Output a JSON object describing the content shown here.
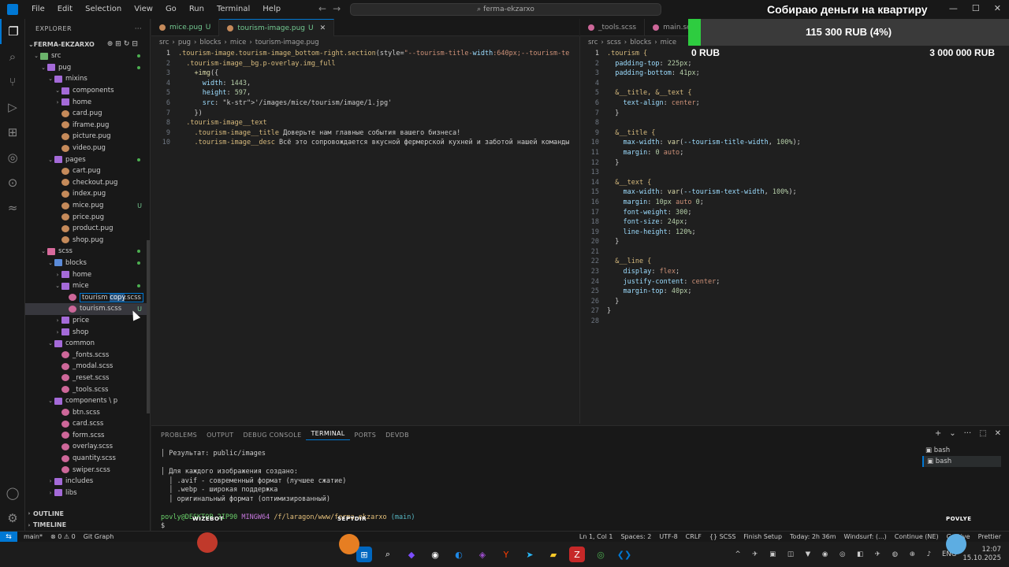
{
  "titlebar": {
    "menu": [
      "File",
      "Edit",
      "Selection",
      "View",
      "Go",
      "Run",
      "Terminal",
      "Help"
    ],
    "search": "ferma-ekzarxo"
  },
  "sidebar": {
    "header": "EXPLORER",
    "project": "FERMA-EKZARXO",
    "rows": [
      {
        "label": "src",
        "indent": 1,
        "type": "folder-src",
        "open": true,
        "dot": true
      },
      {
        "label": "pug",
        "indent": 2,
        "type": "folder",
        "open": true,
        "dot": true
      },
      {
        "label": "mixins",
        "indent": 3,
        "type": "folder",
        "open": true
      },
      {
        "label": "components",
        "indent": 4,
        "type": "folder",
        "open": true
      },
      {
        "label": "home",
        "indent": 4,
        "type": "folder",
        "open": false
      },
      {
        "label": "card.pug",
        "indent": 4,
        "type": "pug"
      },
      {
        "label": "iframe.pug",
        "indent": 4,
        "type": "pug"
      },
      {
        "label": "picture.pug",
        "indent": 4,
        "type": "pug"
      },
      {
        "label": "video.pug",
        "indent": 4,
        "type": "pug"
      },
      {
        "label": "pages",
        "indent": 3,
        "type": "folder",
        "open": true,
        "dot": true
      },
      {
        "label": "cart.pug",
        "indent": 4,
        "type": "pug"
      },
      {
        "label": "checkout.pug",
        "indent": 4,
        "type": "pug"
      },
      {
        "label": "index.pug",
        "indent": 4,
        "type": "pug"
      },
      {
        "label": "mice.pug",
        "indent": 4,
        "type": "pug",
        "badge": "U",
        "green": true
      },
      {
        "label": "price.pug",
        "indent": 4,
        "type": "pug"
      },
      {
        "label": "product.pug",
        "indent": 4,
        "type": "pug"
      },
      {
        "label": "shop.pug",
        "indent": 4,
        "type": "pug"
      },
      {
        "label": "scss",
        "indent": 2,
        "type": "folder-pink",
        "open": true,
        "dot": true
      },
      {
        "label": "blocks",
        "indent": 3,
        "type": "folder-blue",
        "open": true,
        "dot": true
      },
      {
        "label": "home",
        "indent": 4,
        "type": "folder",
        "open": false
      },
      {
        "label": "mice",
        "indent": 4,
        "type": "folder",
        "open": true,
        "dot": true,
        "green": true
      },
      {
        "label": "tourism copy.scss",
        "indent": 5,
        "type": "scss",
        "renaming": true
      },
      {
        "label": "tourism.scss",
        "indent": 5,
        "type": "scss",
        "badge": "U",
        "green": true,
        "selected": true
      },
      {
        "label": "price",
        "indent": 4,
        "type": "folder",
        "open": false
      },
      {
        "label": "shop",
        "indent": 4,
        "type": "folder",
        "open": false
      },
      {
        "label": "common",
        "indent": 3,
        "type": "folder",
        "open": true
      },
      {
        "label": "_fonts.scss",
        "indent": 4,
        "type": "scss"
      },
      {
        "label": "_modal.scss",
        "indent": 4,
        "type": "scss"
      },
      {
        "label": "_reset.scss",
        "indent": 4,
        "type": "scss"
      },
      {
        "label": "_tools.scss",
        "indent": 4,
        "type": "scss"
      },
      {
        "label": "components \\ p",
        "indent": 3,
        "type": "folder",
        "open": true
      },
      {
        "label": "btn.scss",
        "indent": 4,
        "type": "scss"
      },
      {
        "label": "card.scss",
        "indent": 4,
        "type": "scss"
      },
      {
        "label": "form.scss",
        "indent": 4,
        "type": "scss"
      },
      {
        "label": "overlay.scss",
        "indent": 4,
        "type": "scss"
      },
      {
        "label": "quantity.scss",
        "indent": 4,
        "type": "scss"
      },
      {
        "label": "swiper.scss",
        "indent": 4,
        "type": "scss"
      },
      {
        "label": "includes",
        "indent": 3,
        "type": "folder",
        "open": false
      },
      {
        "label": "libs",
        "indent": 3,
        "type": "folder",
        "open": false
      }
    ],
    "outline": "OUTLINE",
    "timeline": "TIMELINE"
  },
  "editor_left": {
    "tabs": [
      {
        "label": "mice.pug",
        "badge": "U",
        "active": false
      },
      {
        "label": "tourism-image.pug",
        "badge": "U",
        "active": true
      }
    ],
    "breadcrumb": [
      "src",
      "pug",
      "blocks",
      "mice",
      "tourism-image.pug"
    ],
    "lines": [
      ".tourism-image.tourism-image_bottom-right.section(style=\"--tourism-title-width:640px;--tourism-te",
      "  .tourism-image__bg.p-overlay.img_full",
      "    +img({",
      "      width: 1443,",
      "      height: 597,",
      "      src: '/images/mice/tourism/image/1.jpg'",
      "    })",
      "  .tourism-image__text",
      "    .tourism-image__title Доверьте нам главные события вашего бизнеса!",
      "    .tourism-image__desc Всё это сопровождается вкусной фермерской кухней и заботой нашей команды"
    ]
  },
  "editor_right": {
    "tabs": [
      {
        "label": "_tools.scss",
        "active": false
      },
      {
        "label": "main.scss",
        "active": false
      }
    ],
    "breadcrumb": [
      "src",
      "scss",
      "blocks",
      "mice"
    ],
    "lines": [
      ".tourism {",
      "  padding-top: 225px;",
      "  padding-bottom: 41px;",
      "",
      "  &__title, &__text {",
      "    text-align: center;",
      "  }",
      "",
      "  &__title {",
      "    max-width: var(--tourism-title-width, 100%);",
      "    margin: 0 auto;",
      "  }",
      "",
      "  &__text {",
      "    max-width: var(--tourism-text-width, 100%);",
      "    margin: 10px auto 0;",
      "    font-weight: 300;",
      "    font-size: 24px;",
      "    line-height: 120%;",
      "  }",
      "",
      "  &__line {",
      "    display: flex;",
      "    justify-content: center;",
      "    margin-top: 40px;",
      "  }",
      "}",
      ""
    ]
  },
  "panel": {
    "tabs": [
      "PROBLEMS",
      "OUTPUT",
      "DEBUG CONSOLE",
      "TERMINAL",
      "PORTS",
      "DEVDB"
    ],
    "active_tab": "TERMINAL",
    "terminal_lines": [
      "│ Результат: public/images",
      "",
      "│ Для каждого изображения создано:",
      "  │ .avif - современный формат (лучшее сжатие)",
      "  │ .webp - широкая поддержка",
      "  │ оригинальный формат (оптимизированный)"
    ],
    "prompt_user": "povly@DESKTOP-2IP90",
    "prompt_shell": "MINGW64",
    "prompt_path": "/f/laragon/www/ferma-ekzarxo",
    "prompt_branch": "(main)",
    "prompt_symbol": "$",
    "terminals": [
      "bash",
      "bash"
    ]
  },
  "statusbar": {
    "left": [
      "main*",
      "⊗ 0  ⚠ 0",
      "Git Graph"
    ],
    "right": [
      "Ln 1, Col 1",
      "Spaces: 2",
      "UTF-8",
      "CRLF",
      "{} SCSS",
      "Finish Setup",
      "Today: 2h 36m",
      "Windsurf: (...)",
      "Continue (NE)",
      "Go Live",
      "Prettier"
    ]
  },
  "taskbar": {
    "lang": "ENG",
    "time": "12:07",
    "date": "15.10.2025"
  },
  "overlay": {
    "title": "Собираю деньги на квартиру",
    "amount": "115 300 RUB (4%)",
    "progress": 0.04,
    "min": "0 RUB",
    "max": "3 000 000 RUB",
    "names": [
      "WIZEBOT",
      "SEPTDIR",
      "POVLYE"
    ]
  },
  "colors": {
    "accent": "#0078d4",
    "progress_fill": "#2ecc40"
  }
}
